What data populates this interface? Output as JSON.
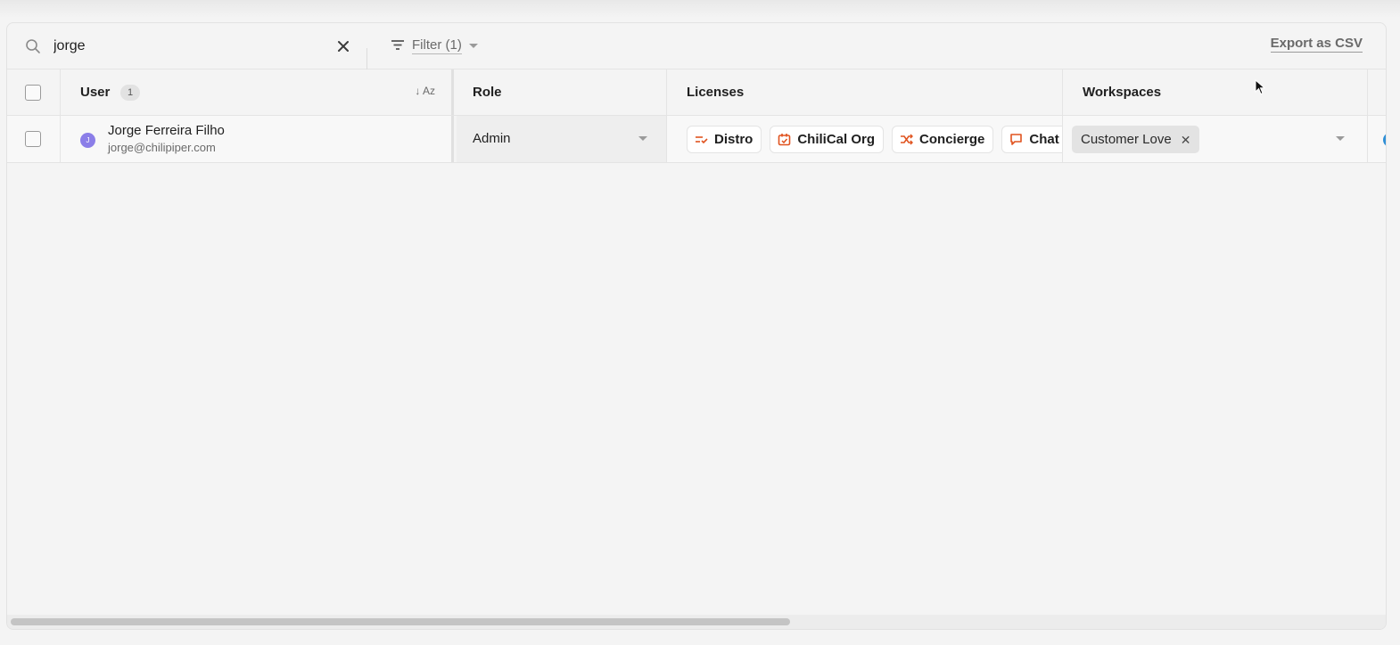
{
  "search": {
    "value": "jorge",
    "placeholder": "Search"
  },
  "toolbar": {
    "filter_label": "Filter (1)",
    "export_label": "Export as CSV"
  },
  "columns": {
    "user": "User",
    "user_count": "1",
    "sort_label": "↓ Az",
    "role": "Role",
    "licenses": "Licenses",
    "workspaces": "Workspaces"
  },
  "rows": [
    {
      "avatar_initial": "J",
      "name": "Jorge Ferreira Filho",
      "email": "jorge@chilipiper.com",
      "role": "Admin",
      "licenses": [
        {
          "label": "Distro",
          "icon": "distro-icon"
        },
        {
          "label": "ChiliCal Org",
          "icon": "calendar-icon"
        },
        {
          "label": "Concierge",
          "icon": "shuffle-icon"
        },
        {
          "label": "Chat",
          "icon": "chat-icon"
        }
      ],
      "workspaces": [
        {
          "label": "Customer Love"
        }
      ]
    }
  ],
  "colors": {
    "accent": "#e0531f",
    "avatar": "#8b7ee8",
    "background": "#f4f4f4"
  }
}
